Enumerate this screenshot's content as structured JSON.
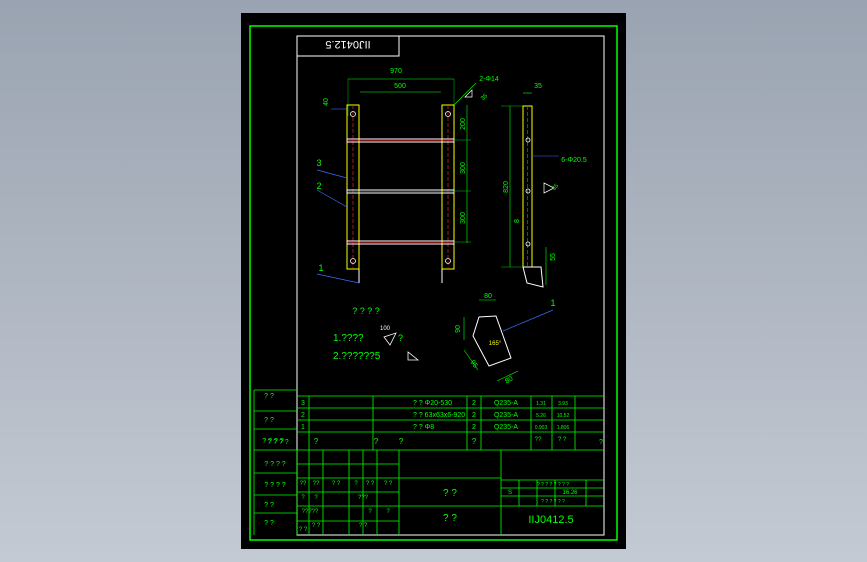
{
  "colors": {
    "background": "#9aa3b1",
    "sheet": "#000000",
    "border": "#00ff00",
    "inner_frame": "#ffffff",
    "dimension": "#00ff00",
    "label": "#00ff00",
    "text": "#00ff00",
    "leader": "#3a6cff",
    "part_yellow": "#ffff00",
    "part_red": "#ff3030",
    "part_white": "#ffffff",
    "center_line": "#ff3030"
  },
  "drawing_code_top": "IIJ0412.5",
  "drawing_code": "IIJ0412.5",
  "front_view": {
    "dims": {
      "overall_width": "970",
      "inner_width": "500",
      "side_offset": "40",
      "top_spacing": "200",
      "mid_spacing": "300",
      "lower_spacing": "300",
      "bolt_note": "2-Φ14",
      "weld_size": "35"
    },
    "balloons": [
      "1",
      "2",
      "3"
    ]
  },
  "side_view": {
    "dims": {
      "width": "35",
      "height": "820",
      "spacing": "8",
      "bottom": "55",
      "weld": "35",
      "hole_note": "6-Φ20.5"
    }
  },
  "detail": {
    "dims": {
      "top": "80",
      "left": "90",
      "angle": "165°",
      "bottom_left": "95",
      "bottom_right": "80"
    },
    "balloon": "1"
  },
  "notes": {
    "title": "? ? ? ?",
    "line1": "1.????",
    "roughness": "100",
    "roughness_suffix": "?",
    "line2": "2.??????5"
  },
  "parts_list": [
    {
      "no": "3",
      "name": "? ? Φ20-530",
      "qty": "2",
      "material": "Q235-A",
      "unit_wt": "1.31",
      "total_wt": "3.93"
    },
    {
      "no": "2",
      "name": "? ? 63x63x6-920",
      "qty": "2",
      "material": "Q235-A",
      "unit_wt": "5.26",
      "total_wt": "10.52"
    },
    {
      "no": "1",
      "name": "? ? Φ8",
      "qty": "2",
      "material": "Q235-A",
      "unit_wt": "0.903",
      "total_wt": "1.806"
    }
  ],
  "parts_header": [
    "? ? ? ?",
    "?",
    "?",
    "?",
    "?",
    "??",
    "? ?",
    "?"
  ],
  "side_labels": [
    "? ?",
    "? ?",
    "? ? ? ?",
    "? ? ? ?",
    "? ? ? ?",
    "? ?",
    "? ?"
  ],
  "title_block": {
    "grid_row1": [
      "??",
      "??",
      "? ?",
      "?",
      "? ?",
      "? ?"
    ],
    "grid_row2": [
      "?",
      "?",
      "???",
      "?",
      "?"
    ],
    "grid_row3": [
      "?????",
      "? ?"
    ],
    "grid_row4": [
      "? ?",
      "? ?"
    ],
    "name_line1": "? ?",
    "name_line2": "? ?",
    "spec_header": "? ? ? ?   ? ?  ? ?",
    "scale": "S",
    "weight": "16.26",
    "sheet_info": "? ? ? ?   ? ?"
  }
}
